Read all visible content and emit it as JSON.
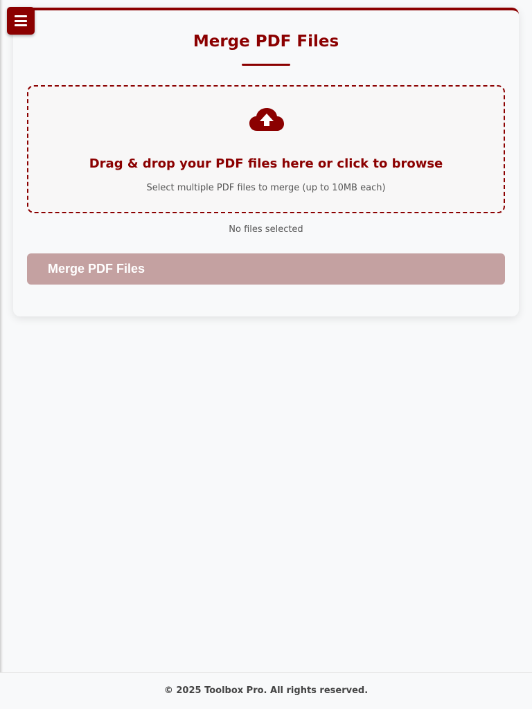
{
  "colors": {
    "accent": "#8b0000",
    "button_disabled": "#c4a1a1",
    "background": "#f8f9fa",
    "muted_text": "#555555"
  },
  "menu": {
    "icon": "hamburger-menu-icon"
  },
  "merge_card": {
    "title": "Merge PDF Files",
    "drop_zone": {
      "icon": "cloud-upload-icon",
      "main_text": "Drag & drop your PDF files here or click to browse",
      "hint_text": "Select multiple PDF files to merge (up to 10MB each)"
    },
    "file_status": "No files selected",
    "merge_button_label": "Merge PDF Files"
  },
  "footer": {
    "copyright": "© 2025 Toolbox Pro. All rights reserved."
  }
}
